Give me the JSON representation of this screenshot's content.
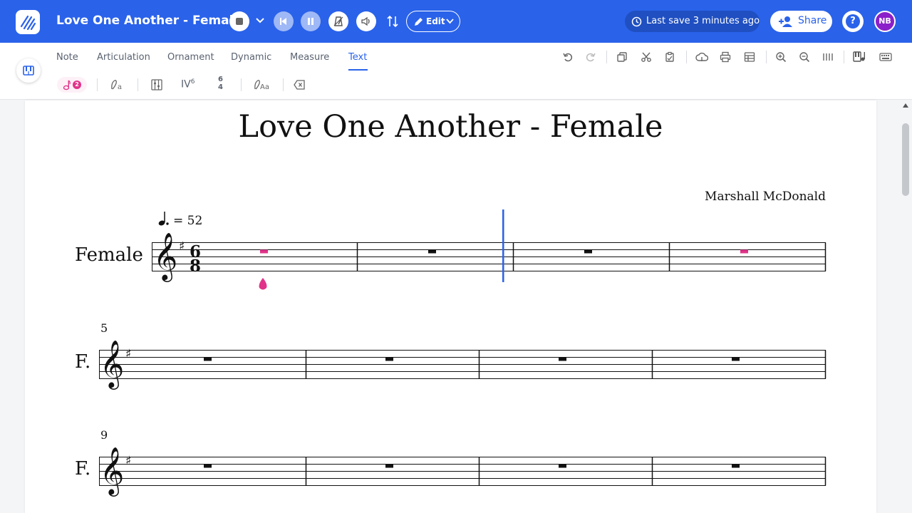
{
  "app": {
    "doc_title": "Love One Another - Female",
    "edit_label": "Edit",
    "save_status": "Last save 3 minutes ago",
    "share_label": "Share",
    "help_glyph": "?",
    "user_initials": "NB",
    "brand_color": "#2a62ea"
  },
  "tabs": [
    {
      "label": "Note"
    },
    {
      "label": "Articulation"
    },
    {
      "label": "Ornament"
    },
    {
      "label": "Dynamic"
    },
    {
      "label": "Measure"
    },
    {
      "label": "Text",
      "active": true
    }
  ],
  "subtoolbar": {
    "note_badge": "2",
    "chord_symbol": "IV",
    "chord_symbol_sup": "6",
    "time_sig_top": "6",
    "time_sig_bottom": "4"
  },
  "score": {
    "title": "Love One Another - Female",
    "composer": "Marshall McDonald",
    "tempo_value": "= 52",
    "first_staff_label": "Female",
    "short_staff_label": "F.",
    "system2_measure_number": "5",
    "system3_measure_number": "9",
    "time_signature": "6/8",
    "key_signature": "G major (1 sharp)",
    "clef": "treble",
    "measures_per_system": 4,
    "all_measures": "whole rest",
    "selected_measures": [
      1,
      4
    ],
    "cursor_after_measure": 2,
    "selection_color": "#e0338a",
    "cursor_color": "#2a62ea"
  },
  "icons": {
    "logo": "flat-logo-icon",
    "stop": "stop-icon",
    "rewind": "rewind-icon",
    "pause": "pause-icon",
    "metronome": "metronome-icon",
    "speaker": "speaker-icon",
    "tuning": "tuning-fork-icon",
    "clock": "clock-icon",
    "add_user": "add-user-icon"
  }
}
